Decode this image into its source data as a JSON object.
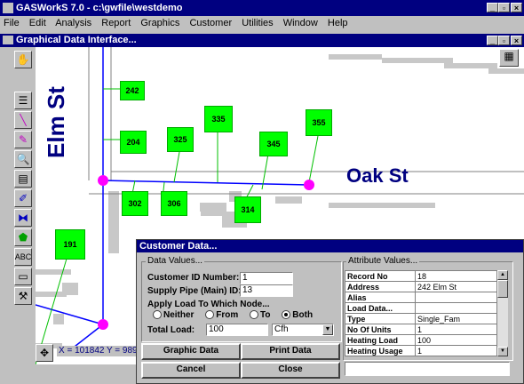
{
  "app": {
    "title": "GASWorkS 7.0 - c:\\gwfile\\westdemo",
    "menu": [
      "File",
      "Edit",
      "Analysis",
      "Report",
      "Graphics",
      "Customer",
      "Utilities",
      "Window",
      "Help"
    ]
  },
  "child_window": {
    "title": "Graphical Data Interface..."
  },
  "map": {
    "streets": {
      "elm": "Elm St",
      "oak": "Oak St"
    },
    "nodes": [
      "242",
      "204",
      "325",
      "335",
      "345",
      "355",
      "302",
      "306",
      "314",
      "191"
    ],
    "coords": "X = 101842  Y = 989"
  },
  "dialog": {
    "title": "Customer Data...",
    "data_values_label": "Data Values...",
    "customer_id_label": "Customer ID Number:",
    "customer_id_value": "1",
    "supply_pipe_label": "Supply Pipe (Main) ID:",
    "supply_pipe_value": "13",
    "apply_load_label": "Apply Load To Which Node...",
    "radio": {
      "neither": "Neither",
      "from": "From",
      "to": "To",
      "both": "Both",
      "selected": "both"
    },
    "total_load_label": "Total Load:",
    "total_load_value": "100",
    "unit_value": "Cfh",
    "buttons": {
      "graphic": "Graphic Data",
      "print": "Print Data",
      "cancel": "Cancel",
      "close": "Close"
    },
    "attr_label": "Attribute Values...",
    "attributes": [
      [
        "Record No",
        "18"
      ],
      [
        "Address",
        "242 Elm St"
      ],
      [
        "Alias",
        ""
      ],
      [
        "Load Data...",
        ""
      ],
      [
        "Type",
        "Single_Fam"
      ],
      [
        "No Of Units",
        "1"
      ],
      [
        "Heating Load",
        "100"
      ],
      [
        "Heating Usage",
        "1"
      ]
    ]
  },
  "colors": {
    "node": "#00ff00",
    "pipe": "#0000ff",
    "marker": "#ff00ff",
    "titlebar": "#000080"
  }
}
